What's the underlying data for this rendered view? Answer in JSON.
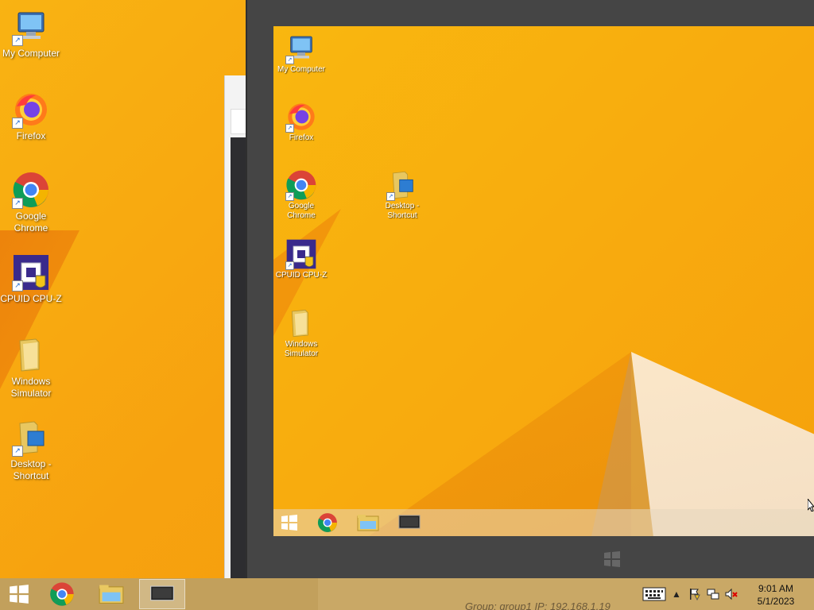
{
  "desktop": {
    "icons": [
      {
        "label": "My Computer"
      },
      {
        "label": "Firefox"
      },
      {
        "label": "Google Chrome"
      },
      {
        "label": "CPUID CPU-Z"
      },
      {
        "label": "Windows Simulator"
      },
      {
        "label": "Desktop - Shortcut"
      }
    ]
  },
  "remote": {
    "icons": [
      {
        "label": "My Computer"
      },
      {
        "label": "Firefox"
      },
      {
        "label": "Google Chrome"
      },
      {
        "label": "Desktop - Shortcut"
      },
      {
        "label": "CPUID CPU-Z"
      },
      {
        "label": "Windows Simulator"
      }
    ]
  },
  "taskbar": {
    "clock_time": "9:01 AM",
    "clock_date": "5/1/2023",
    "overlay_text": "Group: group1   IP: 192.168.1.19"
  },
  "colors": {
    "desktop_bg": "#f7a20f",
    "taskbar_bg": "#c2a05c",
    "remote_frame": "#454545"
  }
}
